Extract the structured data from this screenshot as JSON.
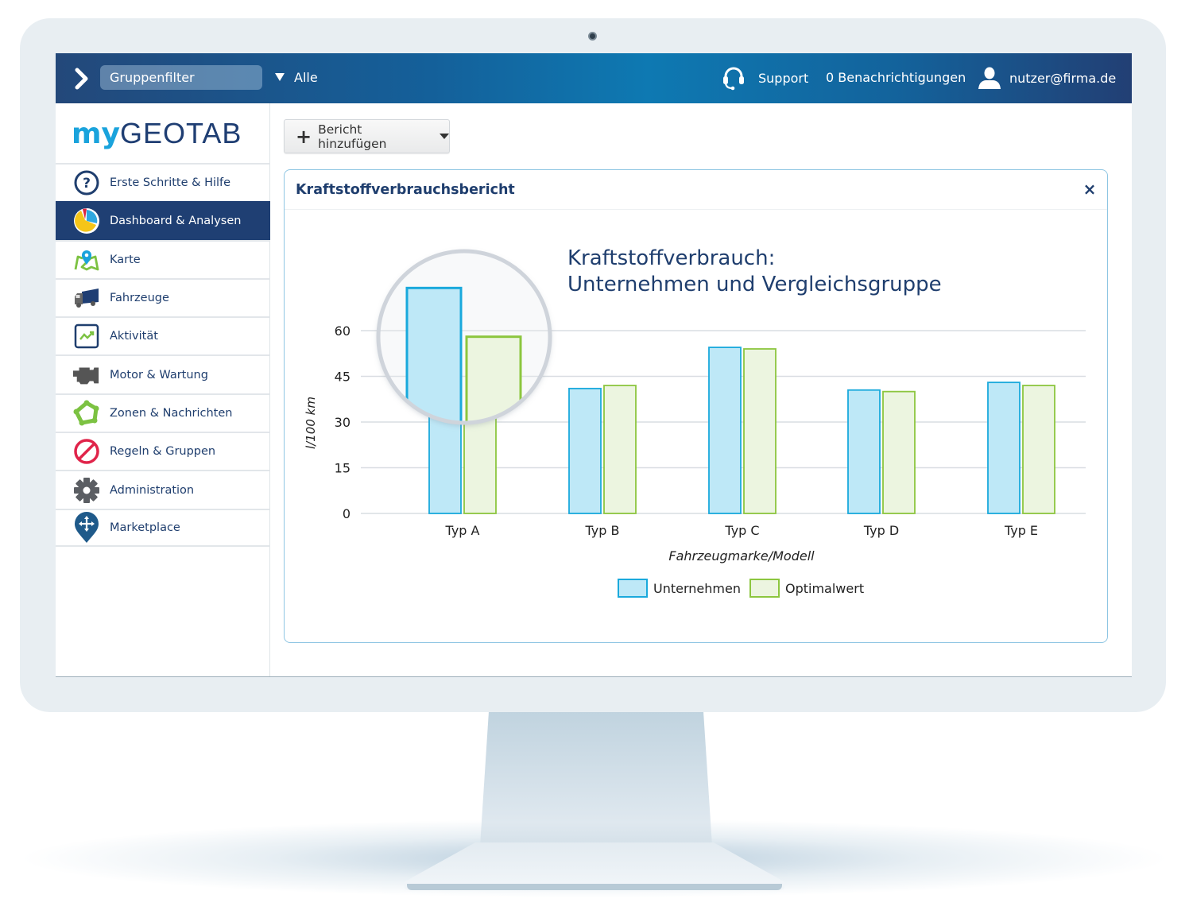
{
  "topbar": {
    "menu_icon": "chevron-right-icon",
    "group_filter_label": "Gruppenfilter",
    "group_filter_value": "Alle",
    "support_label": "Support",
    "support_icon": "headset-icon",
    "notifications_label": "0 Benachrichtigungen",
    "user_icon": "user-icon",
    "user_email": "nutzer@firma.de"
  },
  "brand": {
    "prefix": "my",
    "name": "GEOTAB"
  },
  "sidebar": {
    "items": [
      {
        "label": "Erste Schritte & Hilfe",
        "icon": "help-icon",
        "active": false
      },
      {
        "label": "Dashboard & Analysen",
        "icon": "pie-chart-icon",
        "active": true
      },
      {
        "label": "Karte",
        "icon": "map-icon",
        "active": false
      },
      {
        "label": "Fahrzeuge",
        "icon": "truck-icon",
        "active": false
      },
      {
        "label": "Aktivität",
        "icon": "activity-icon",
        "active": false
      },
      {
        "label": "Motor & Wartung",
        "icon": "engine-icon",
        "active": false
      },
      {
        "label": "Zonen & Nachrichten",
        "icon": "zone-icon",
        "active": false
      },
      {
        "label": "Regeln & Gruppen",
        "icon": "prohibited-icon",
        "active": false
      },
      {
        "label": "Administration",
        "icon": "gear-icon",
        "active": false
      },
      {
        "label": "Marketplace",
        "icon": "marketplace-pin-icon",
        "active": false
      }
    ]
  },
  "toolbar": {
    "add_report_label": "Bericht hinzufügen"
  },
  "panel": {
    "title": "Kraftstoffverbrauchsbericht",
    "close_label": "×"
  },
  "colors": {
    "series1_fill": "#bee8f7",
    "series1_stroke": "#1aa9dc",
    "series2_fill": "#ecf5e0",
    "series2_stroke": "#8cc63f",
    "navy": "#1f3e6e"
  },
  "chart_data": {
    "type": "bar",
    "title_line1": "Kraftstoffverbrauch:",
    "title_line2": "Unternehmen und Vergleichsgruppe",
    "xlabel": "Fahrzeugmarke/Modell",
    "ylabel": "l/100 km",
    "categories": [
      "Typ A",
      "Typ B",
      "Typ C",
      "Typ D",
      "Typ E"
    ],
    "yticks": [
      0,
      15,
      30,
      45,
      60
    ],
    "ylim": [
      0,
      60
    ],
    "grid": true,
    "legend_position": "bottom",
    "series": [
      {
        "name": "Unternehmen",
        "values": [
          74,
          41,
          54.5,
          40.5,
          43
        ]
      },
      {
        "name": "Optimalwert",
        "values": [
          58,
          42,
          54,
          40,
          42
        ]
      }
    ],
    "magnifier_category": "Typ A"
  }
}
